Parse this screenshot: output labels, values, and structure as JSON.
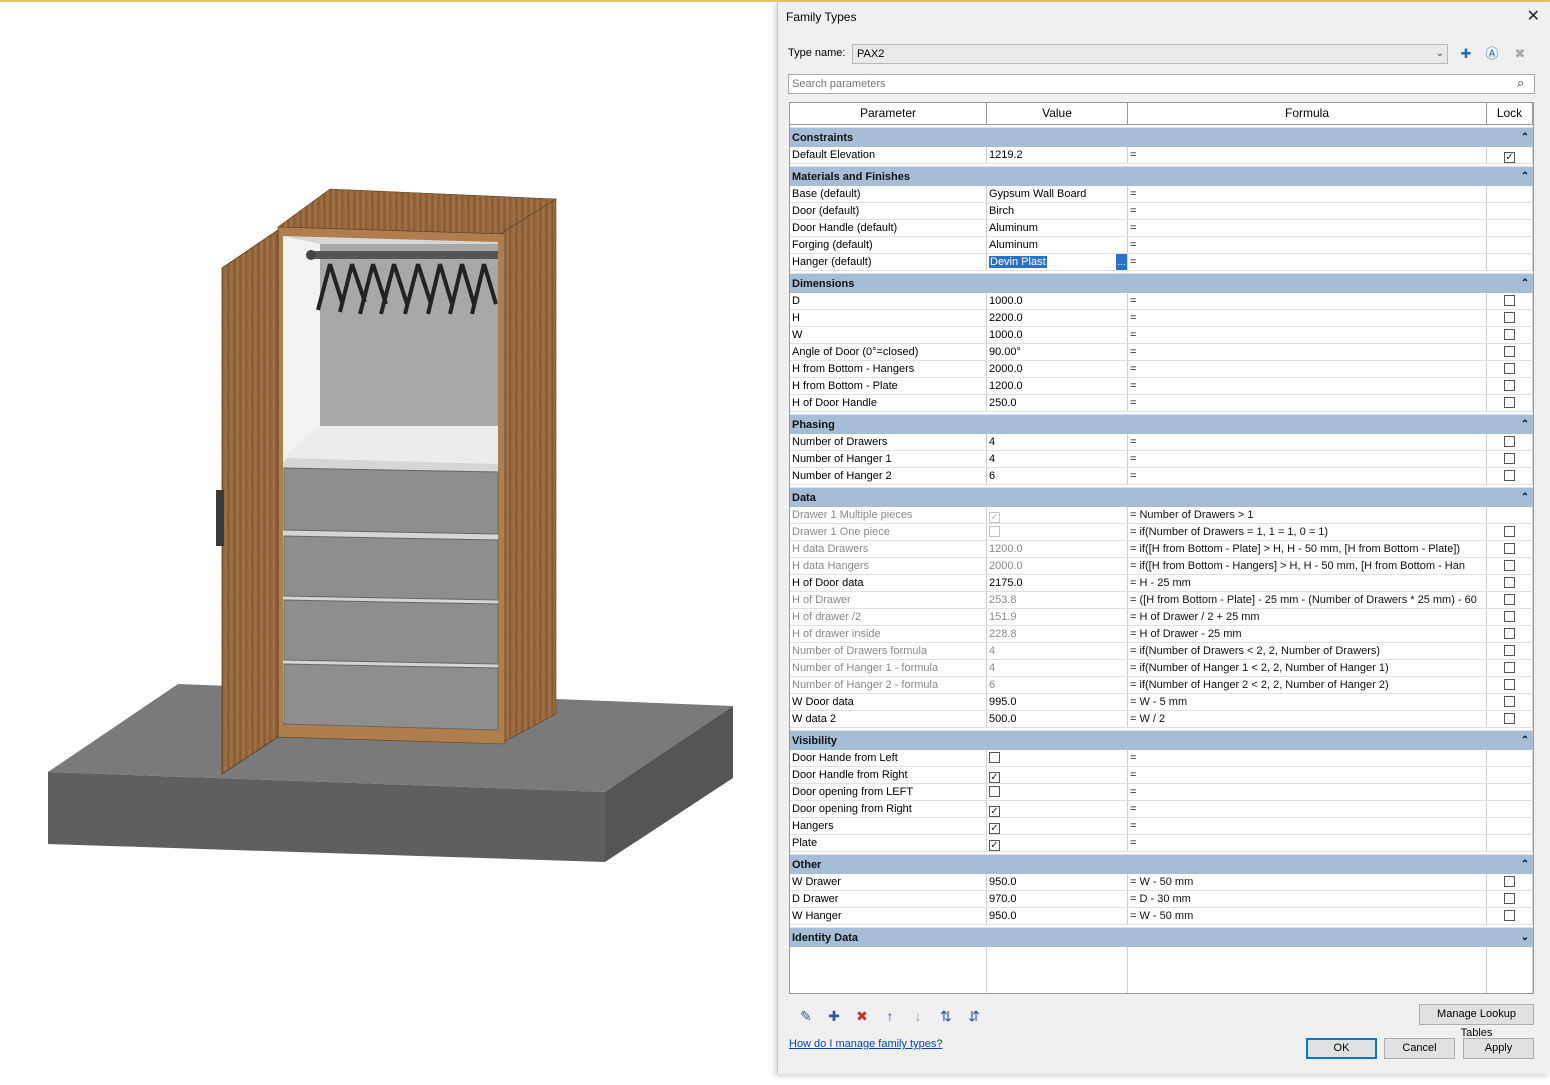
{
  "dialog": {
    "title": "Family Types",
    "close_icon": "close-icon",
    "type_name_label": "Type name:",
    "type_name_value": "PAX2",
    "search_placeholder": "Search parameters",
    "columns": [
      "Parameter",
      "Value",
      "Formula",
      "Lock"
    ],
    "groups": [
      {
        "name": "Constraints",
        "toggle": "⌃",
        "rows": [
          {
            "param": "Default Elevation",
            "value": "1219.2",
            "formula": "=",
            "lock": "checked"
          }
        ]
      },
      {
        "name": "Materials and Finishes",
        "toggle": "⌃",
        "rows": [
          {
            "param": "Base (default)",
            "value": "Gypsum Wall Board",
            "formula": "=",
            "lock": "none"
          },
          {
            "param": "Door (default)",
            "value": "Birch",
            "formula": "=",
            "lock": "none"
          },
          {
            "param": "Door Handle (default)",
            "value": "Aluminum",
            "formula": "=",
            "lock": "none"
          },
          {
            "param": "Forging (default)",
            "value": "Aluminum",
            "formula": "=",
            "lock": "none"
          },
          {
            "param": "Hanger (default)",
            "value": "Devin Plast",
            "formula": "=",
            "lock": "none",
            "selected": true
          }
        ]
      },
      {
        "name": "Dimensions",
        "toggle": "⌃",
        "rows": [
          {
            "param": "D",
            "value": "1000.0",
            "formula": "=",
            "lock": "unchecked"
          },
          {
            "param": "H",
            "value": "2200.0",
            "formula": "=",
            "lock": "unchecked"
          },
          {
            "param": "W",
            "value": "1000.0",
            "formula": "=",
            "lock": "unchecked"
          },
          {
            "param": "Angle of Door (0°=closed)",
            "value": "90.00°",
            "formula": "=",
            "lock": "unchecked"
          },
          {
            "param": "H from Bottom - Hangers",
            "value": "2000.0",
            "formula": "=",
            "lock": "unchecked"
          },
          {
            "param": "H from Bottom - Plate",
            "value": "1200.0",
            "formula": "=",
            "lock": "unchecked"
          },
          {
            "param": "H of Door Handle",
            "value": "250.0",
            "formula": "=",
            "lock": "unchecked"
          }
        ]
      },
      {
        "name": "Phasing",
        "toggle": "⌃",
        "rows": [
          {
            "param": "Number of Drawers",
            "value": "4",
            "formula": "=",
            "lock": "unchecked"
          },
          {
            "param": "Number of Hanger 1",
            "value": "4",
            "formula": "=",
            "lock": "unchecked"
          },
          {
            "param": "Number of Hanger 2",
            "value": "6",
            "formula": "=",
            "lock": "unchecked"
          }
        ]
      },
      {
        "name": "Data",
        "toggle": "⌃",
        "rows": [
          {
            "param": "Drawer 1 Multiple pieces",
            "value": "",
            "valuebox": "checked-dim",
            "formula": "= Number of Drawers > 1",
            "lock": "none",
            "dim": true
          },
          {
            "param": "Drawer 1 One piece",
            "value": "",
            "valuebox": "unchecked-dim",
            "formula": "= if(Number of Drawers = 1, 1 = 1, 0 = 1)",
            "lock": "unchecked",
            "dim": true
          },
          {
            "param": "H data Drawers",
            "value": "1200.0",
            "formula": "= if([H from Bottom - Plate] > H, H - 50 mm, [H from Bottom - Plate])",
            "lock": "unchecked",
            "dim": true
          },
          {
            "param": "H data Hangers",
            "value": "2000.0",
            "formula": "= if([H from Bottom - Hangers] > H, H - 50 mm, [H from Bottom - Han",
            "lock": "unchecked",
            "dim": true
          },
          {
            "param": "H of Door data",
            "value": "2175.0",
            "formula": "= H - 25 mm",
            "lock": "unchecked"
          },
          {
            "param": "H of Drawer",
            "value": "253.8",
            "formula": "= ([H from Bottom - Plate] - 25 mm - (Number of Drawers * 25 mm) - 60",
            "lock": "unchecked",
            "dim": true
          },
          {
            "param": "H of drawer /2",
            "value": "151.9",
            "formula": "= H of Drawer / 2 + 25 mm",
            "lock": "unchecked",
            "dim": true
          },
          {
            "param": "H of drawer inside",
            "value": "228.8",
            "formula": "= H of Drawer - 25 mm",
            "lock": "unchecked",
            "dim": true
          },
          {
            "param": "Number of Drawers  formula",
            "value": "4",
            "formula": "= if(Number of Drawers < 2, 2, Number of Drawers)",
            "lock": "unchecked",
            "dim": true
          },
          {
            "param": "Number of Hanger 1 - formula",
            "value": "4",
            "formula": "= if(Number of Hanger 1 < 2, 2, Number of Hanger 1)",
            "lock": "unchecked",
            "dim": true
          },
          {
            "param": "Number of Hanger 2 - formula",
            "value": "6",
            "formula": "= if(Number of Hanger 2 < 2, 2, Number of Hanger 2)",
            "lock": "unchecked",
            "dim": true
          },
          {
            "param": "W Door data",
            "value": "995.0",
            "formula": "= W - 5 mm",
            "lock": "unchecked"
          },
          {
            "param": "W data 2",
            "value": "500.0",
            "formula": "= W / 2",
            "lock": "unchecked"
          }
        ]
      },
      {
        "name": "Visibility",
        "toggle": "⌃",
        "rows": [
          {
            "param": "Door Hande from Left",
            "value": "",
            "valuebox": "unchecked",
            "formula": "=",
            "lock": "none"
          },
          {
            "param": "Door Handle from Right",
            "value": "",
            "valuebox": "checked",
            "formula": "=",
            "lock": "none"
          },
          {
            "param": "Door opening from LEFT",
            "value": "",
            "valuebox": "unchecked",
            "formula": "=",
            "lock": "none"
          },
          {
            "param": "Door opening from Right",
            "value": "",
            "valuebox": "checked",
            "formula": "=",
            "lock": "none"
          },
          {
            "param": "Hangers",
            "value": "",
            "valuebox": "checked",
            "formula": "=",
            "lock": "none"
          },
          {
            "param": "Plate",
            "value": "",
            "valuebox": "checked",
            "formula": "=",
            "lock": "none"
          }
        ]
      },
      {
        "name": "Other",
        "toggle": "⌃",
        "rows": [
          {
            "param": "W Drawer",
            "value": "950.0",
            "formula": "= W - 50 mm",
            "lock": "unchecked"
          },
          {
            "param": "D Drawer",
            "value": "970.0",
            "formula": "= D - 30 mm",
            "lock": "unchecked"
          },
          {
            "param": "W Hanger",
            "value": "950.0",
            "formula": "= W - 50 mm",
            "lock": "unchecked"
          }
        ]
      },
      {
        "name": "Identity Data",
        "toggle": "⌄",
        "rows": []
      }
    ],
    "bottom_icons": [
      "pencil-icon",
      "new-parameter-icon",
      "delete-parameter-icon",
      "move-up-icon",
      "move-down-icon",
      "sort-ascending-icon",
      "sort-descending-icon"
    ],
    "manage_lookup_label": "Manage Lookup Tables",
    "help_link": "How do I manage family types?",
    "ok_label": "OK",
    "cancel_label": "Cancel",
    "apply_label": "Apply"
  },
  "colors": {
    "group_header": "#a5bdd6",
    "selection": "#2a72c9",
    "wood": "#9a6a3c",
    "floor": "#6c6c6c"
  }
}
